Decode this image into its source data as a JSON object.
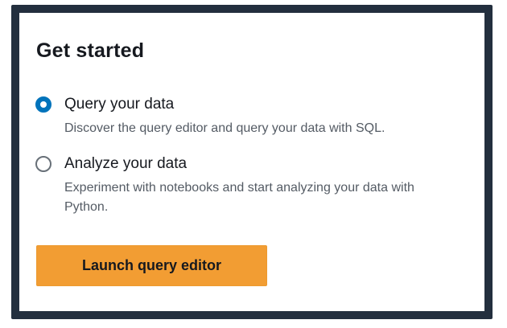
{
  "panel": {
    "title": "Get started"
  },
  "options": [
    {
      "label": "Query your data",
      "description": "Discover the query editor and query your data with SQL.",
      "selected": true
    },
    {
      "label": "Analyze your data",
      "description": "Experiment with notebooks and start analyzing your data with Python.",
      "selected": false
    }
  ],
  "actions": {
    "launch_label": "Launch query editor"
  },
  "colors": {
    "frame": "#232f3e",
    "radio_selected": "#0073bb",
    "primary_button": "#f29d33",
    "title_text": "#16191f",
    "description_text": "#545b64"
  }
}
